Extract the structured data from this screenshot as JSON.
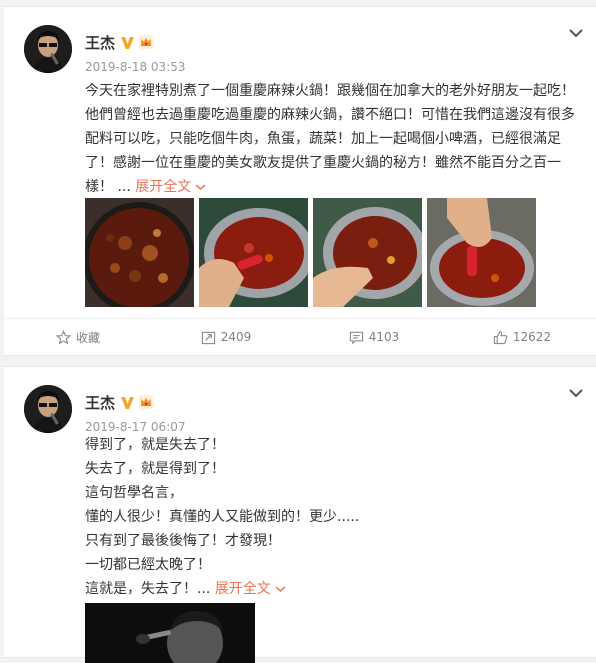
{
  "posts": [
    {
      "author": "王杰",
      "timestamp": "2019-8-18 03:53",
      "text_lines": [
        "今天在家裡特別煮了一個重慶麻辣火鍋！跟幾個在加拿大的老外好朋友一起吃！",
        "他們曾經也去過重慶吃過重慶的麻辣火鍋，讚不絕口！可惜在我們這邊沒有很多",
        "配料可以吃，只能吃個牛肉，魚蛋，蔬菜！加上一起喝個小啤酒，已經很滿足",
        "了！感謝一位在重慶的美女歌友提供了重慶火鍋的秘方！雖然不能百分之百一",
        "樣！"
      ],
      "ellipsis": "...",
      "expand_label": "展开全文",
      "actions": {
        "favorite_label": "收藏",
        "repost_count": "2409",
        "comment_count": "4103",
        "like_count": "12622"
      }
    },
    {
      "author": "王杰",
      "timestamp": "2019-8-17 06:07",
      "text_lines": [
        "得到了，就是失去了！",
        "失去了，就是得到了！",
        "這句哲學名言，",
        "懂的人很少！真懂的人又能做到的！更少.....",
        "只有到了最後後悔了！才發現！",
        "一切都已經太晚了！",
        "這就是，失去了！"
      ],
      "ellipsis": "...",
      "expand_label": "展开全文"
    }
  ],
  "colors": {
    "accent": "#eb7350",
    "text": "#333333",
    "muted": "#999999",
    "vip_badge": "#f5a623"
  },
  "icons": {
    "verified": "verified-v-icon",
    "vip": "crown-icon",
    "menu": "chevron-down-icon",
    "favorite": "star-icon",
    "repost": "repost-icon",
    "comment": "comment-icon",
    "like": "thumbs-up-icon"
  }
}
